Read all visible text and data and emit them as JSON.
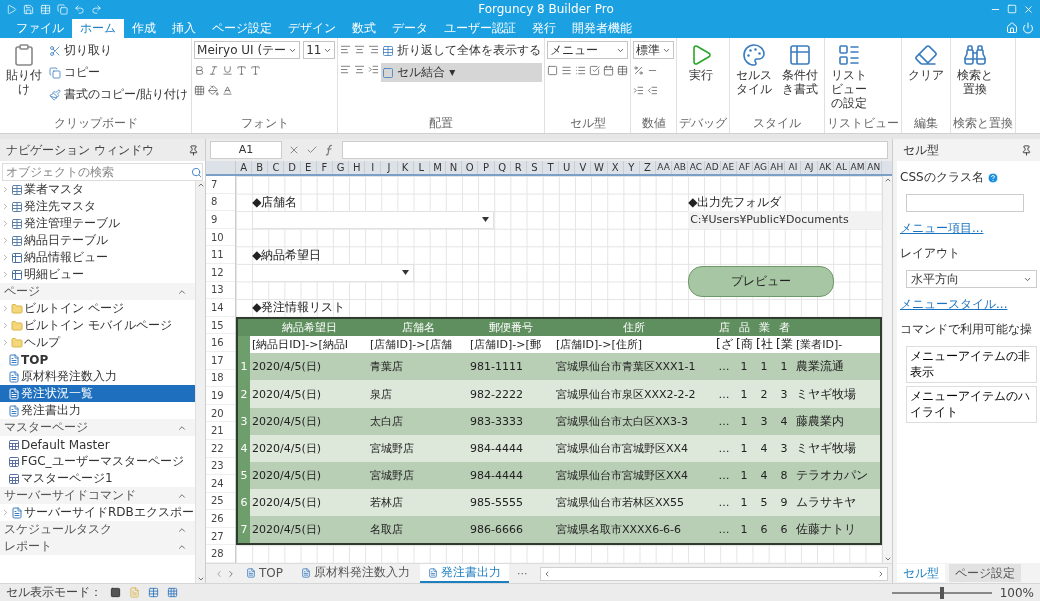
{
  "window": {
    "title": "Forguncy 8 Builder Pro"
  },
  "menu_tabs": [
    {
      "label": "ファイル",
      "selected": false
    },
    {
      "label": "ホーム",
      "selected": true
    },
    {
      "label": "作成",
      "selected": false
    },
    {
      "label": "挿入",
      "selected": false
    },
    {
      "label": "ページ設定",
      "selected": false
    },
    {
      "label": "デザイン",
      "selected": false
    },
    {
      "label": "数式",
      "selected": false
    },
    {
      "label": "データ",
      "selected": false
    },
    {
      "label": "ユーザー認証",
      "selected": false
    },
    {
      "label": "発行",
      "selected": false
    },
    {
      "label": "開発者機能",
      "selected": false
    }
  ],
  "ribbon": {
    "groups": [
      {
        "label": "クリップボード",
        "columns": [
          [
            {
              "kind": "large",
              "label": "貼り付け"
            }
          ],
          [
            {
              "kind": "small",
              "label": "切り取り"
            },
            {
              "kind": "small",
              "label": "コピー"
            },
            {
              "kind": "small",
              "label": "書式のコピー/貼り付け"
            }
          ]
        ]
      },
      {
        "label": "フォント",
        "columns": [
          [
            {
              "kind": "selects",
              "values": [
                "Meiryo UI (テー",
                "11"
              ]
            },
            {
              "kind": "icons"
            },
            {
              "kind": "icons"
            }
          ]
        ]
      },
      {
        "label": "配置",
        "columns": [
          [
            {
              "kind": "icons"
            },
            {
              "kind": "icons"
            }
          ],
          [
            {
              "kind": "small",
              "label": "折り返して全体を表示する"
            },
            {
              "kind": "small",
              "label": "セル結合 ▾"
            }
          ]
        ]
      },
      {
        "label": "セル型",
        "columns": [
          [
            {
              "kind": "select",
              "value": "メニュー"
            },
            {
              "kind": "icons"
            }
          ]
        ]
      },
      {
        "label": "数値",
        "columns": [
          [
            {
              "kind": "select",
              "value": "標準"
            },
            {
              "kind": "icons"
            },
            {
              "kind": "icons"
            }
          ]
        ]
      },
      {
        "label": "デバッグ",
        "columns": [
          [
            {
              "kind": "large",
              "label": "実行"
            }
          ]
        ]
      },
      {
        "label": "スタイル",
        "columns": [
          [
            {
              "kind": "large",
              "label": "セルスタイル"
            }
          ],
          [
            {
              "kind": "large",
              "label": "条件付き書式"
            }
          ]
        ]
      },
      {
        "label": "リストビュー",
        "columns": [
          [
            {
              "kind": "large",
              "label": "リストビューの設定"
            }
          ]
        ]
      },
      {
        "label": "編集",
        "columns": [
          [
            {
              "kind": "large",
              "label": "クリア"
            }
          ]
        ]
      },
      {
        "label": "検索と置換",
        "columns": [
          [
            {
              "kind": "large",
              "label": "検索と置換"
            }
          ]
        ]
      }
    ]
  },
  "navigation": {
    "title": "ナビゲーション ウィンドウ",
    "search": {
      "placeholder": "オブジェクトの検索"
    },
    "sections": [
      {
        "items": [
          {
            "label": "業者マスタ",
            "kind": "table",
            "collapsed": true,
            "selected": false,
            "start_page": false
          },
          {
            "label": "発注先マスタ",
            "kind": "table",
            "collapsed": true,
            "selected": false,
            "start_page": false
          },
          {
            "label": "発注管理テーブル",
            "kind": "table",
            "collapsed": true,
            "selected": false,
            "start_page": false
          },
          {
            "label": "納品日テーブル",
            "kind": "table",
            "collapsed": true,
            "selected": false,
            "start_page": false
          },
          {
            "label": "納品情報ビュー",
            "kind": "view",
            "collapsed": true,
            "selected": false,
            "start_page": false
          },
          {
            "label": "明細ビュー",
            "kind": "view",
            "collapsed": true,
            "selected": false,
            "start_page": false
          }
        ]
      },
      {
        "title": "ページ",
        "expanded": true,
        "items": [
          {
            "label": "ビルトイン ページ",
            "kind": "folder",
            "collapsed": true,
            "selected": false,
            "start_page": false
          },
          {
            "label": "ビルトイン モバイルページ",
            "kind": "folder",
            "collapsed": true,
            "selected": false,
            "start_page": false
          },
          {
            "label": "ヘルプ",
            "kind": "folder",
            "collapsed": true,
            "selected": false,
            "start_page": false
          },
          {
            "label": "TOP",
            "kind": "page",
            "collapsed": false,
            "selected": false,
            "start_page": true
          },
          {
            "label": "原材料発注数入力",
            "kind": "page",
            "collapsed": false,
            "selected": false,
            "start_page": false
          },
          {
            "label": "発注状況一覧",
            "kind": "page",
            "collapsed": false,
            "selected": true,
            "start_page": false
          },
          {
            "label": "発注書出力",
            "kind": "page",
            "collapsed": false,
            "selected": false,
            "start_page": false
          }
        ]
      },
      {
        "title": "マスターページ",
        "expanded": true,
        "items": [
          {
            "label": "Default Master",
            "kind": "master",
            "collapsed": false,
            "selected": false,
            "start_page": false
          },
          {
            "label": "FGC_ユーザーマスターページ",
            "kind": "master",
            "collapsed": false,
            "selected": false,
            "start_page": false
          },
          {
            "label": "マスターページ1",
            "kind": "master",
            "collapsed": false,
            "selected": false,
            "start_page": false
          }
        ]
      },
      {
        "title": "サーバーサイドコマンド",
        "expanded": true,
        "items": [
          {
            "label": "サーバーサイドRDBエクスポー",
            "kind": "command",
            "collapsed": true,
            "selected": false,
            "start_page": false
          }
        ]
      },
      {
        "title": "スケジュールタスク",
        "expanded": true
      },
      {
        "title": "レポート",
        "expanded": true
      }
    ]
  },
  "formula_bar": {
    "cell": "A1"
  },
  "sheet": {
    "columns": [
      "A",
      "B",
      "C",
      "D",
      "E",
      "F",
      "G",
      "H",
      "I",
      "J",
      "K",
      "L",
      "M",
      "N",
      "O",
      "P",
      "Q",
      "R",
      "S",
      "T",
      "U",
      "V",
      "W",
      "X",
      "Y",
      "Z",
      "AA",
      "AB",
      "AC",
      "AD",
      "AE",
      "AF",
      "AG",
      "AH",
      "AI",
      "AJ",
      "AK",
      "AL",
      "AM",
      "AN"
    ],
    "rows": [
      "7",
      "8",
      "9",
      "10",
      "11",
      "12",
      "13",
      "14",
      "15",
      "16",
      "17",
      "18",
      "19",
      "20",
      "21",
      "22",
      "23",
      "24",
      "25",
      "26",
      "27",
      "28"
    ],
    "store_label": "◆店舗名",
    "date_label": "◆納品希望日",
    "folder_label": "◆出力先フォルダ",
    "folder_path": "C:¥Users¥Public¥Documents",
    "preview_button": "プレビュー",
    "list_label": "◆発注情報リスト",
    "list_view": {
      "columns": [
        {
          "header": "納品希望日",
          "binding": "[納品日ID]->[納品I"
        },
        {
          "header": "店舗名",
          "binding": "[店舗ID]->[店舗"
        },
        {
          "header": "郵便番号",
          "binding": "[店舗ID]->[郵"
        },
        {
          "header": "住所",
          "binding": "[店舗ID]->[住所]"
        },
        {
          "header": "店",
          "binding": "[ざ"
        },
        {
          "header": "品",
          "binding": "[商"
        },
        {
          "header": "業",
          "binding": "[社"
        },
        {
          "header": "者",
          "binding": "[業"
        },
        {
          "binding": "[業者ID]-"
        }
      ],
      "rows": [
        {
          "index": "1",
          "cells": [
            "2020/4/5(日)",
            "青葉店",
            "981-1111",
            "宮城県仙台市青葉区XXX1-1",
            "…",
            "1",
            "1",
            "1",
            "農業流通"
          ]
        },
        {
          "index": "2",
          "cells": [
            "2020/4/5(日)",
            "泉店",
            "982-2222",
            "宮城県仙台市泉区XXX2-2-2",
            "…",
            "1",
            "2",
            "3",
            "ミヤギ牧場"
          ]
        },
        {
          "index": "3",
          "cells": [
            "2020/4/5(日)",
            "太白店",
            "983-3333",
            "宮城県仙台市太白区XX3-3",
            "…",
            "1",
            "3",
            "4",
            "藤農業内"
          ]
        },
        {
          "index": "4",
          "cells": [
            "2020/4/5(日)",
            "宮城野店",
            "984-4444",
            "宮城県仙台市宮城野区XX4",
            "…",
            "1",
            "4",
            "3",
            "ミヤギ牧場"
          ]
        },
        {
          "index": "5",
          "cells": [
            "2020/4/5(日)",
            "宮城野店",
            "984-4444",
            "宮城県仙台市宮城野区XX4",
            "…",
            "1",
            "4",
            "8",
            "テラオカパン"
          ]
        },
        {
          "index": "6",
          "cells": [
            "2020/4/5(日)",
            "若林店",
            "985-5555",
            "宮城県仙台市若林区XX55",
            "…",
            "1",
            "5",
            "9",
            "ムラサキヤ"
          ]
        },
        {
          "index": "7",
          "cells": [
            "2020/4/5(日)",
            "名取店",
            "986-6666",
            "宮城県名取市XXXX6-6-6",
            "…",
            "1",
            "6",
            "6",
            "佐藤ナトリ"
          ]
        }
      ]
    }
  },
  "sheet_tabs": [
    {
      "label": "TOP",
      "selected": false
    },
    {
      "label": "原材料発注数入力",
      "selected": false
    },
    {
      "label": "発注書出力",
      "selected": true
    }
  ],
  "sheet_tabs_more": "···",
  "properties": {
    "title": "セル型",
    "css_label": "CSSのクラス名",
    "menu_items_link": "メニュー項目...",
    "layout_label": "レイアウト",
    "layout_value": "水平方向",
    "menu_style_link": "メニュースタイル...",
    "commands_label": "コマンドで利用可能な操",
    "command_buttons": [
      "メニューアイテムの非表示",
      "メニューアイテムのハイライト"
    ],
    "tabs": [
      {
        "label": "セル型",
        "selected": true
      },
      {
        "label": "ページ設定",
        "selected": false
      }
    ]
  },
  "status_bar": {
    "mode_label": "セル表示モード：",
    "zoom": {
      "level": 0.5,
      "reading": "100%"
    }
  }
}
